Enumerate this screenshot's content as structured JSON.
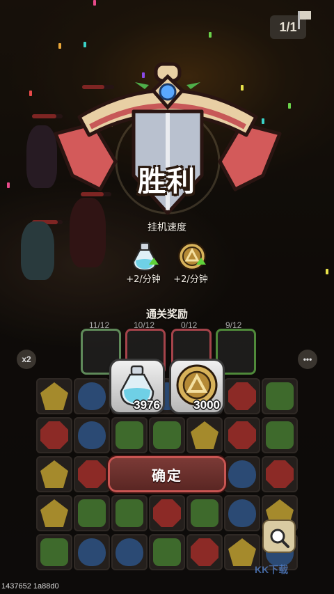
{
  "hud": {
    "stage_progress": "1/1"
  },
  "victory": {
    "title": "胜利",
    "idle_speed_label": "挂机速度",
    "rates": [
      {
        "icon": "potion-icon",
        "text": "+2/分钟"
      },
      {
        "icon": "coin-icon",
        "text": "+2/分钟"
      }
    ],
    "rewards_title": "通关奖励",
    "rewards": [
      {
        "icon": "potion-icon",
        "count": "3976"
      },
      {
        "icon": "coin-icon",
        "count": "3000"
      }
    ],
    "confirm_label": "确定"
  },
  "hero_cards": [
    {
      "count": "11/12",
      "border": "#5f8a5a"
    },
    {
      "count": "10/12",
      "border": "#a5434a"
    },
    {
      "count": "0/12",
      "border": "#a5434a"
    },
    {
      "count": "9/12",
      "border": "#4f8a3a"
    }
  ],
  "side": {
    "speed_label": "x2",
    "more_label": "•••"
  },
  "board": {
    "rows": [
      [
        "y",
        "b",
        "y",
        "b",
        "y",
        "r",
        "g"
      ],
      [
        "r",
        "b",
        "g",
        "g",
        "y",
        "r",
        "g"
      ],
      [
        "y",
        "r",
        "b",
        "g",
        "g",
        "b",
        "r"
      ],
      [
        "y",
        "g",
        "g",
        "r",
        "g",
        "b",
        "y"
      ],
      [
        "g",
        "b",
        "b",
        "g",
        "r",
        "y",
        "b"
      ]
    ]
  },
  "footer": {
    "id_text": "1437652 1a88d0"
  },
  "watermark": "KK下载",
  "colors": {
    "confirm": "#6b302c",
    "potion": "#6fd0e6",
    "coin": "#c69a3a"
  }
}
